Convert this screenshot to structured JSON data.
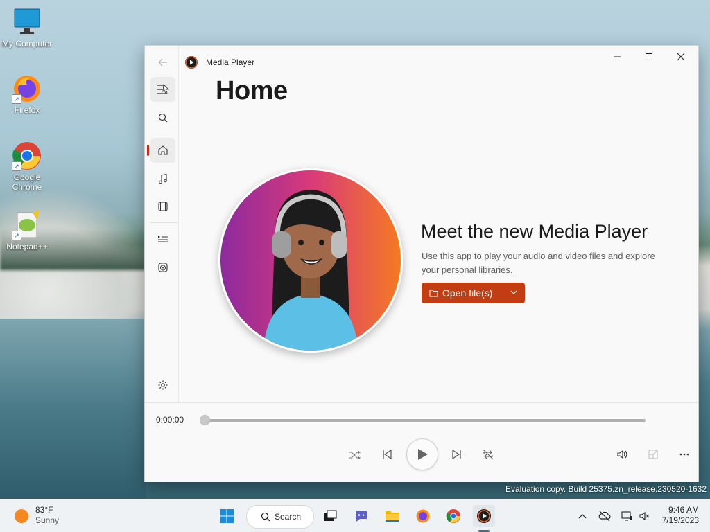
{
  "desktop": {
    "icons": [
      {
        "label": "My Computer"
      },
      {
        "label": "Firefox"
      },
      {
        "label": "Google Chrome"
      },
      {
        "label": "Notepad++"
      }
    ],
    "eval_text": "Evaluation copy. Build 25375.zn_release.230520-1632"
  },
  "window": {
    "app_title": "Media Player",
    "page_title": "Home",
    "promo_title": "Meet the new Media Player",
    "promo_desc": "Use this app to play your audio and video files and explore your personal libraries.",
    "open_button": "Open file(s)",
    "time": "0:00:00",
    "progress": 0
  },
  "rail": {
    "items": [
      "back",
      "menu",
      "search",
      "home",
      "music",
      "video",
      "playlists",
      "disc",
      "settings"
    ],
    "selected": "home"
  },
  "taskbar": {
    "weather_temp": "83°F",
    "weather_cond": "Sunny",
    "search_label": "Search",
    "time": "9:46 AM",
    "date": "7/19/2023"
  },
  "colors": {
    "accent": "#c23d12",
    "indicator": "#c42b1c"
  }
}
